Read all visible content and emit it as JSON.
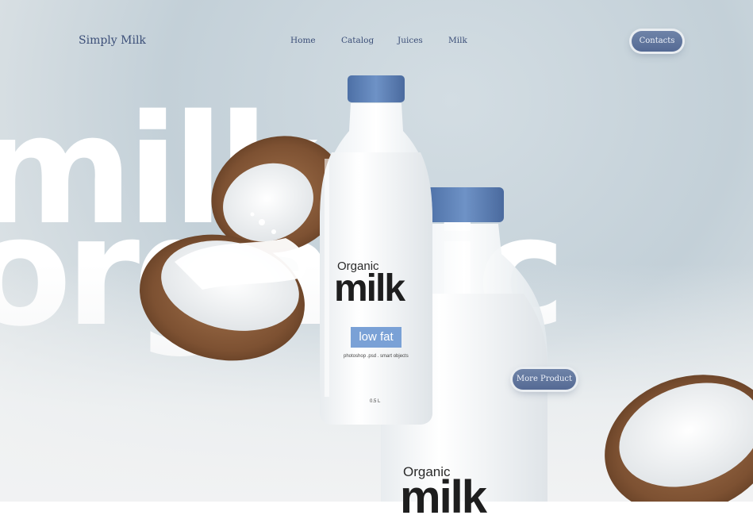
{
  "brand": {
    "name": "Simply Milk"
  },
  "nav": {
    "items": [
      "Home",
      "Catalog",
      "Juices",
      "Milk"
    ]
  },
  "header": {
    "contacts_label": "Contacts"
  },
  "hero": {
    "bg_word_1": "milk",
    "bg_word_2": "organic",
    "more_product_label": "More Product"
  },
  "bottle_front": {
    "organic": "Organic",
    "milk": "milk",
    "badge": "low fat",
    "subtext": "photoshop .psd . smart objects",
    "volume": "0.5 L"
  },
  "bottle_back": {
    "organic": "Organic",
    "milk": "milk"
  },
  "colors": {
    "accent": "#5f739d",
    "label_blue": "#7aa1d6",
    "cap_blue": "#5a7fb5",
    "text_navy": "#3c4f78"
  }
}
